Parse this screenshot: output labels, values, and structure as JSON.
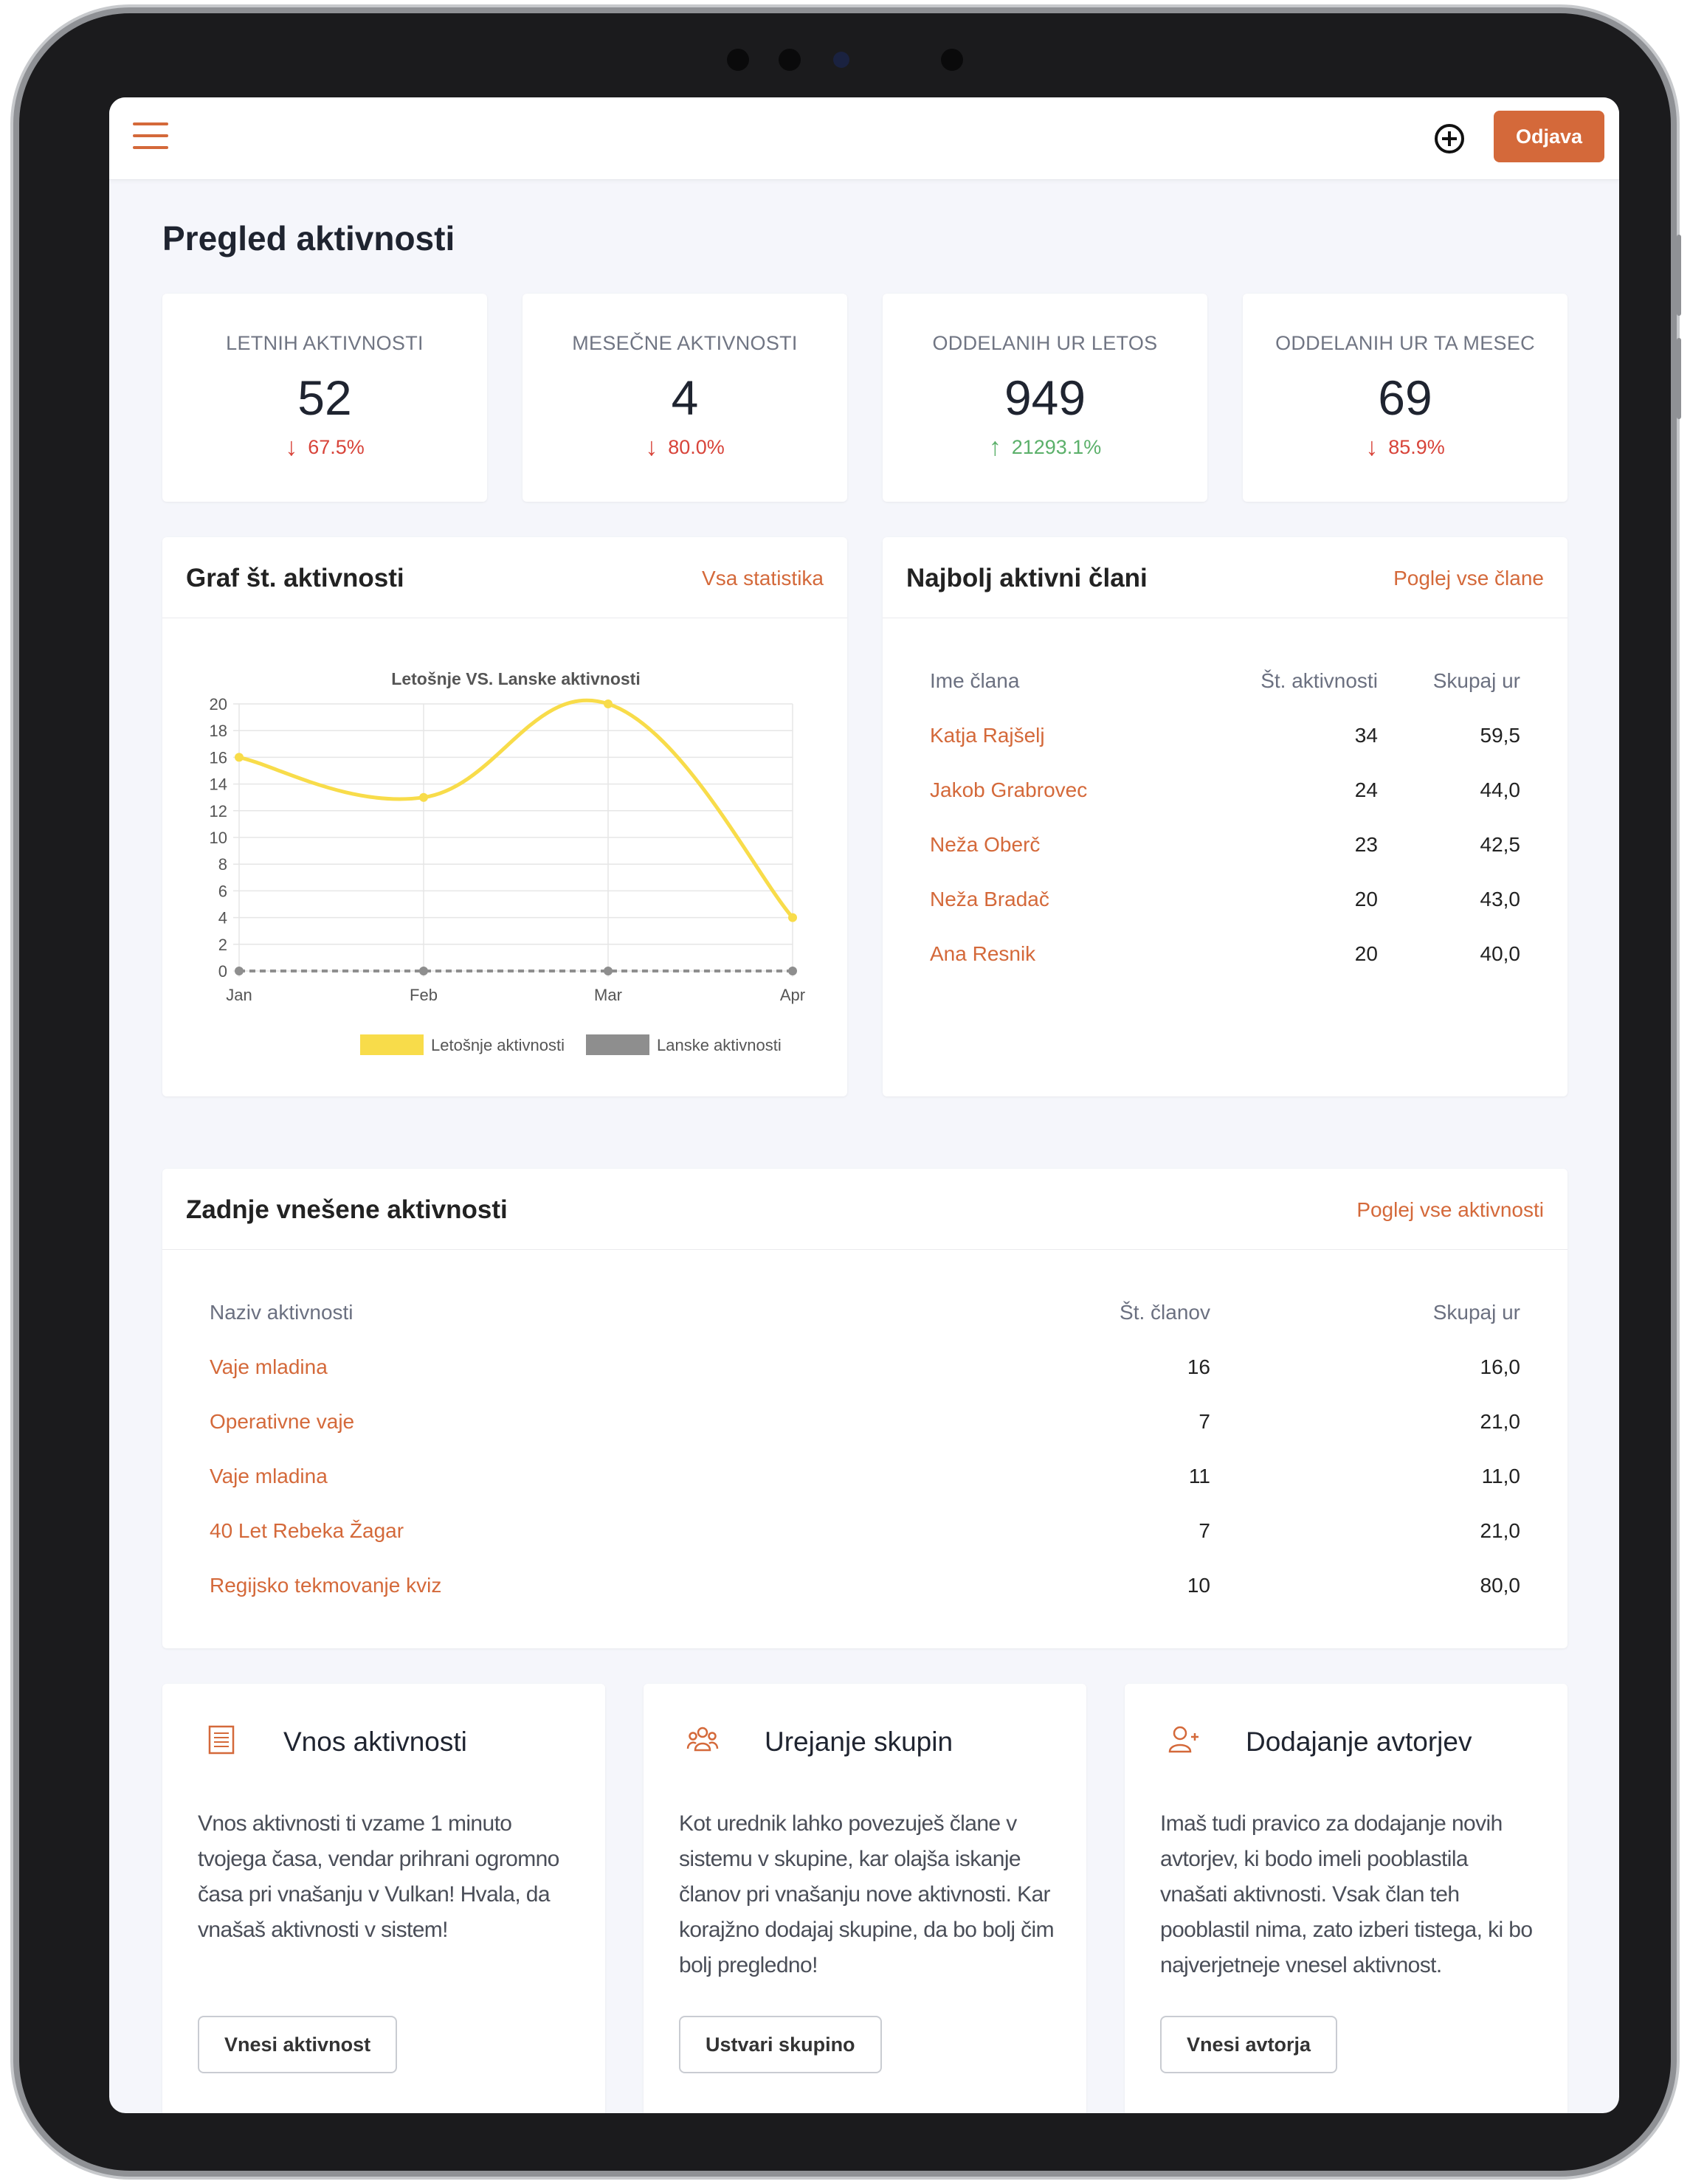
{
  "header": {
    "logout_label": "Odjava"
  },
  "page_title": "Pregled aktivnosti",
  "stats": [
    {
      "label": "LETNIH AKTIVNOSTI",
      "value": "52",
      "change": "67.5%",
      "direction": "down"
    },
    {
      "label": "MESEČNE AKTIVNOSTI",
      "value": "4",
      "change": "80.0%",
      "direction": "down"
    },
    {
      "label": "ODDELANIH UR LETOS",
      "value": "949",
      "change": "21293.1%",
      "direction": "up"
    },
    {
      "label": "ODDELANIH UR TA MESEC",
      "value": "69",
      "change": "85.9%",
      "direction": "down"
    }
  ],
  "chart_card": {
    "title": "Graf št. aktivnosti",
    "link": "Vsa statistika"
  },
  "chart_data": {
    "type": "line",
    "title": "Letošnje VS. Lanske aktivnosti",
    "categories": [
      "Jan",
      "Feb",
      "Mar",
      "Apr"
    ],
    "series": [
      {
        "name": "Letošnje aktivnosti",
        "values": [
          16,
          13,
          20,
          4
        ],
        "color": "#f8dc4a"
      },
      {
        "name": "Lanske aktivnosti",
        "values": [
          0,
          0,
          0,
          0
        ],
        "color": "#8e8e8e"
      }
    ],
    "ylim": [
      0,
      20
    ],
    "yticks": [
      "0",
      "2",
      "4",
      "6",
      "8",
      "10",
      "12",
      "14",
      "16",
      "18",
      "20"
    ],
    "grid": true,
    "legend": "bottom"
  },
  "members_card": {
    "title": "Najbolj aktivni člani",
    "link": "Poglej vse člane",
    "columns": [
      "Ime člana",
      "Št. aktivnosti",
      "Skupaj ur"
    ],
    "rows": [
      [
        "Katja Rajšelj",
        "34",
        "59,5"
      ],
      [
        "Jakob Grabrovec",
        "24",
        "44,0"
      ],
      [
        "Neža Oberč",
        "23",
        "42,5"
      ],
      [
        "Neža Bradač",
        "20",
        "43,0"
      ],
      [
        "Ana Resnik",
        "20",
        "40,0"
      ]
    ]
  },
  "activities_card": {
    "title": "Zadnje vnešene aktivnosti",
    "link": "Poglej vse aktivnosti",
    "columns": [
      "Naziv aktivnosti",
      "Št. članov",
      "Skupaj ur"
    ],
    "rows": [
      [
        "Vaje mladina",
        "16",
        "16,0"
      ],
      [
        "Operativne vaje",
        "7",
        "21,0"
      ],
      [
        "Vaje mladina",
        "11",
        "11,0"
      ],
      [
        "40 Let Rebeka Žagar",
        "7",
        "21,0"
      ],
      [
        "Regijsko tekmovanje kviz",
        "10",
        "80,0"
      ]
    ]
  },
  "features": [
    {
      "icon": "document-list-icon",
      "title": "Vnos aktivnosti",
      "text": "Vnos aktivnosti ti vzame 1 minuto tvojega časa, vendar prihrani ogromno časa pri vnašanju v Vulkan! Hvala, da vnašaš aktivnosti v sistem!",
      "button": "Vnesi aktivnost"
    },
    {
      "icon": "users-group-icon",
      "title": "Urejanje skupin",
      "text": "Kot urednik lahko povezuješ člane v sistemu v skupine, kar olajša iskanje članov pri vnašanju nove aktivnosti. Kar korajžno dodajaj skupine, da bo bolj čim bolj pregledno!",
      "button": "Ustvari skupino"
    },
    {
      "icon": "user-add-icon",
      "title": "Dodajanje avtorjev",
      "text": "Imaš tudi pravico za dodajanje novih avtorjev, ki bodo imeli pooblastila vnašati aktivnosti. Vsak član teh pooblastil nima, zato izberi tistega, ki bo najverjetneje vnesel aktivnost.",
      "button": "Vnesi avtorja"
    }
  ],
  "colors": {
    "accent": "#d4693a",
    "down": "#d8443a",
    "up": "#5bb06a",
    "chart_this_year": "#f8dc4a",
    "chart_last_year": "#8e8e8e"
  }
}
